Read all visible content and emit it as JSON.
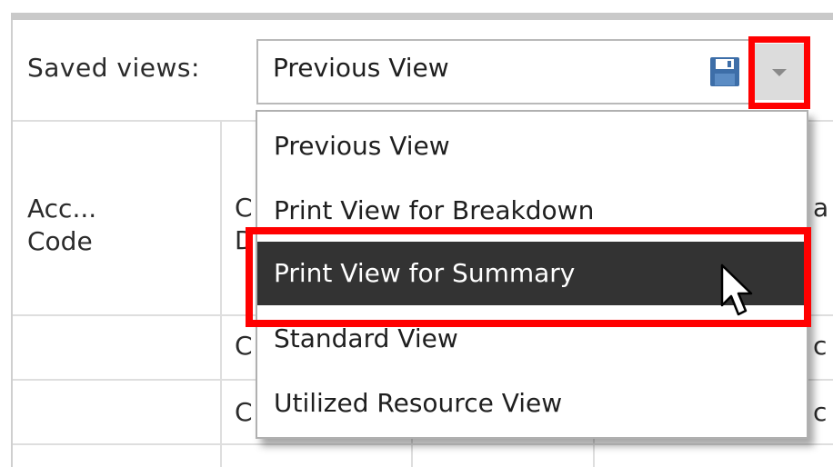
{
  "saved_views": {
    "label": "Saved views:",
    "selected": "Previous View"
  },
  "dropdown": {
    "options": [
      "Previous View",
      "Print View for Breakdown",
      "Print View for Summary",
      "Standard View",
      "Utilized Resource View"
    ],
    "highlighted_index": 2
  },
  "table": {
    "header_line1": "Acc...",
    "header_line2": "Code"
  },
  "icons": {
    "save": "save-icon",
    "dropdown": "chevron-down-icon",
    "cursor": "mouse-pointer-icon"
  },
  "colors": {
    "highlight_bg": "#333333",
    "annotation_red": "#ff0000",
    "save_icon": "#3d6ea8"
  }
}
